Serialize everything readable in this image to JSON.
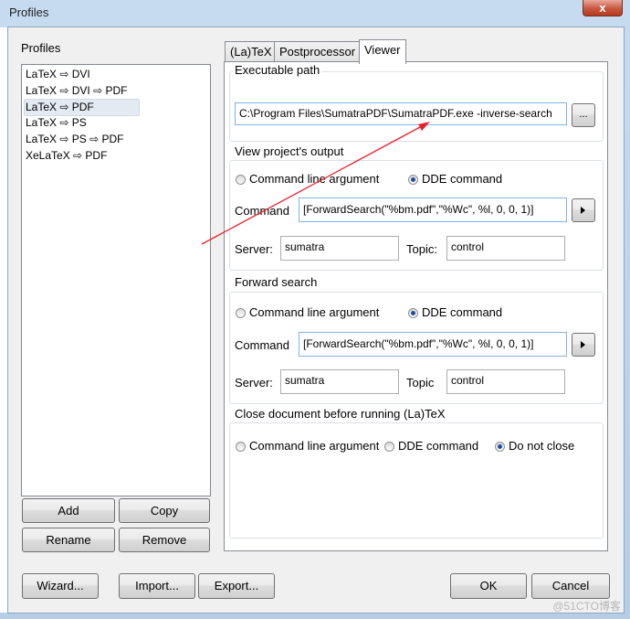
{
  "window": {
    "title": "Profiles",
    "close_glyph": "x"
  },
  "profiles": {
    "label": "Profiles",
    "items": [
      {
        "label": "LaTeX ⇨ DVI"
      },
      {
        "label": "LaTeX ⇨ DVI ⇨ PDF"
      },
      {
        "label": "LaTeX ⇨ PDF",
        "selected": true
      },
      {
        "label": "LaTeX ⇨ PS"
      },
      {
        "label": "LaTeX ⇨ PS ⇨ PDF"
      },
      {
        "label": "XeLaTeX ⇨ PDF"
      }
    ],
    "add_label": "Add",
    "copy_label": "Copy",
    "rename_label": "Rename",
    "remove_label": "Remove"
  },
  "tabs": {
    "latex": "(La)TeX",
    "postprocessor": "Postprocessor",
    "viewer": "Viewer",
    "active": "viewer"
  },
  "executable": {
    "group_title": "Executable path",
    "value": "C:\\Program Files\\SumatraPDF\\SumatraPDF.exe -inverse-search",
    "browse_label": "..."
  },
  "view_output": {
    "group_title": "View project's output",
    "radio_cmd_label": "Command line argument",
    "radio_dde_label": "DDE command",
    "selected": "dde",
    "command_label": "Command",
    "command_value": "[ForwardSearch(\"%bm.pdf\",\"%Wc\", %l, 0, 0, 1)]",
    "server_label": "Server:",
    "server_value": "sumatra",
    "topic_label": "Topic:",
    "topic_value": "control"
  },
  "forward_search": {
    "group_title": "Forward search",
    "radio_cmd_label": "Command line argument",
    "radio_dde_label": "DDE command",
    "selected": "dde",
    "command_label": "Command",
    "command_value": "[ForwardSearch(\"%bm.pdf\",\"%Wc\", %l, 0, 0, 1)]",
    "server_label": "Server:",
    "server_value": "sumatra",
    "topic_label": "Topic",
    "topic_value": "control"
  },
  "close_doc": {
    "group_title": "Close document before running (La)TeX",
    "radio_cmd_label": "Command line argument",
    "radio_dde_label": "DDE command",
    "radio_noclose_label": "Do not close",
    "selected": "do_not_close"
  },
  "footer": {
    "wizard_label": "Wizard...",
    "import_label": "Import...",
    "export_label": "Export...",
    "ok_label": "OK",
    "cancel_label": "Cancel"
  },
  "watermark": "@51CTO博客",
  "colors": {
    "arrow": "#e8202a",
    "titlebar": "#c7dbf0",
    "close_button": "#c7573f"
  }
}
